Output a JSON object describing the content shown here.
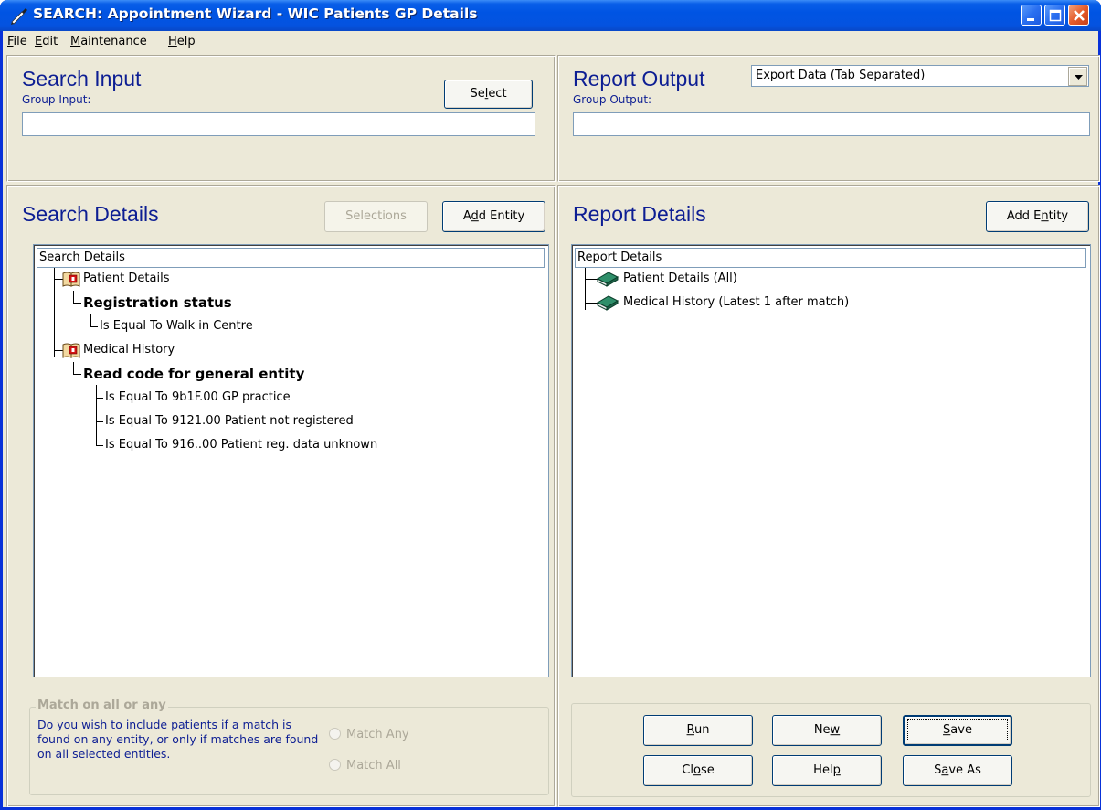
{
  "window": {
    "title": "SEARCH: Appointment Wizard - WIC  Patients GP Details"
  },
  "menu": {
    "file": {
      "pre": "",
      "u": "F",
      "post": "ile"
    },
    "edit": {
      "pre": "",
      "u": "E",
      "post": "dit"
    },
    "maintenance": {
      "pre": "",
      "u": "M",
      "post": "aintenance"
    },
    "help": {
      "pre": "",
      "u": "H",
      "post": "elp"
    }
  },
  "search_input": {
    "heading": "Search Input",
    "group_label": "Group Input:",
    "select_button": {
      "pre": "Se",
      "u": "l",
      "post": "ect"
    },
    "group_value": ""
  },
  "report_output": {
    "heading": "Report Output",
    "group_label": "Group Output:",
    "dropdown_value": "Export Data (Tab Separated)",
    "group_value": ""
  },
  "search_details": {
    "heading": "Search Details",
    "selections_button": "Selections",
    "add_entity_button": {
      "pre": "A",
      "u": "d",
      "post": "d Entity"
    },
    "tree": {
      "root": "Search Details",
      "patient_details": "Patient Details",
      "registration_status": "Registration status",
      "walk_in": "Is Equal To Walk in Centre",
      "medical_history": "Medical History",
      "read_code": "Read code for general entity",
      "gp_practice": "Is Equal To 9b1F.00 GP practice",
      "not_registered": "Is Equal To 9121.00 Patient not registered",
      "reg_unknown": "Is Equal To 916..00 Patient reg. data unknown"
    }
  },
  "report_details": {
    "heading": "Report Details",
    "add_entity_button": {
      "pre": "Add E",
      "u": "n",
      "post": "tity"
    },
    "tree": {
      "root": "Report Details",
      "patient_details": "Patient Details (All)",
      "medical_history": "Medical History (Latest 1 after match)"
    }
  },
  "match": {
    "title": "Match on all or any",
    "description": "Do you wish to include patients if a match is found on any entity, or only if matches are found on all selected entities.",
    "option_any": "Match Any",
    "option_all": "Match All"
  },
  "actions": {
    "run": {
      "pre": "",
      "u": "R",
      "post": "un"
    },
    "new": {
      "pre": "Ne",
      "u": "w",
      "post": ""
    },
    "save": {
      "pre": "",
      "u": "S",
      "post": "ave"
    },
    "close": {
      "pre": "Cl",
      "u": "o",
      "post": "se"
    },
    "help": {
      "pre": "Hel",
      "u": "p",
      "post": ""
    },
    "save_as": {
      "pre": "S",
      "u": "a",
      "post": "ve As"
    }
  },
  "colors": {
    "heading": "#0d1e93",
    "titlebar": "#0054e3",
    "window_bg": "#ece9d8"
  },
  "icons": {
    "title": "pen-icon",
    "search_entity": "book-record-icon",
    "report_entity": "green-book-icon"
  }
}
